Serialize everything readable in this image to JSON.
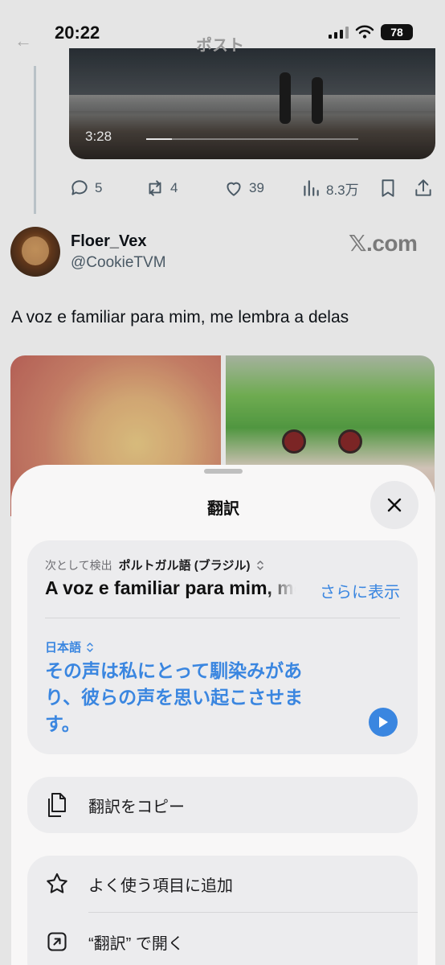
{
  "status": {
    "time": "20:22",
    "battery": "78"
  },
  "header": {
    "title": "ポスト"
  },
  "video": {
    "time": "3:28",
    "progress": 0.12
  },
  "actions": {
    "replies": "5",
    "reposts": "4",
    "likes": "39",
    "views": "8.3万"
  },
  "author": {
    "name": "Floer_Vex",
    "handle": "@CookieTVM",
    "watermark": "𝕏.com"
  },
  "post": {
    "text": "A voz e familiar para mim, me lembra a delas"
  },
  "sheet": {
    "title": "翻訳",
    "detected_prefix": "次として検出",
    "detected_language": "ポルトガル語 (ブラジル)",
    "source_text": "A voz e familiar para mim, me lembra a delas",
    "show_more": "さらに表示",
    "target_language": "日本語",
    "translation": "その声は私にとって馴染みがあり、彼らの声を思い起こさせます。",
    "copy_label": "翻訳をコピー",
    "favorite_label": "よく使う項目に追加",
    "open_label": "“翻訳” で開く"
  },
  "colors": {
    "accent": "#3a86e0",
    "sheet_bg": "#f8f7f7",
    "card_bg": "#ececee"
  },
  "icons": [
    "back-arrow-icon",
    "signal-icon",
    "wifi-icon",
    "battery-icon",
    "reply-icon",
    "repost-icon",
    "like-icon",
    "views-icon",
    "bookmark-icon",
    "share-icon",
    "close-icon",
    "chevron-updown-icon",
    "play-icon",
    "copy-icon",
    "star-icon",
    "open-external-icon"
  ]
}
